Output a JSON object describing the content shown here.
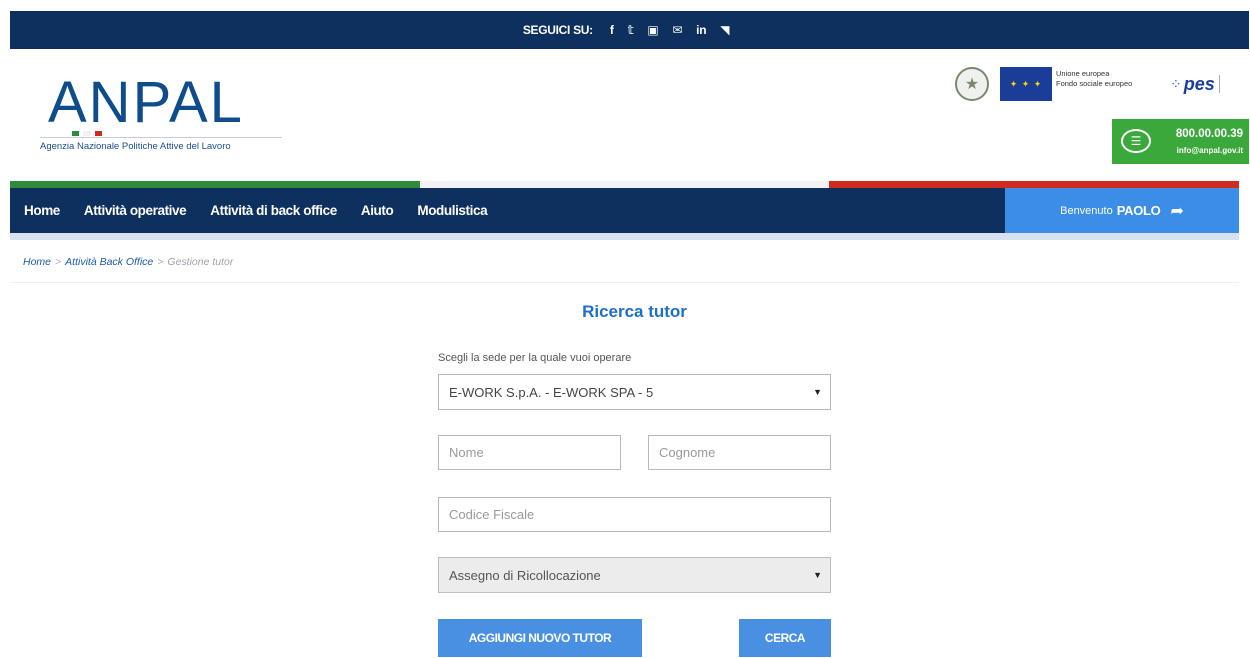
{
  "social": {
    "label": "SEGUICI SU:",
    "icons": [
      "facebook-icon",
      "twitter-icon",
      "youtube-icon",
      "mail-icon",
      "linkedin-icon",
      "rss-icon"
    ],
    "glyphs": [
      "f",
      "𝕥",
      "▣",
      "✉",
      "in",
      "◥"
    ]
  },
  "header": {
    "logo_text": "ANPAL",
    "logo_subtitle": "Agenzia Nazionale Politiche Attive del Lavoro",
    "eu_line1": "Unione europea",
    "eu_line2": "Fondo sociale europeo",
    "pes_text": "pes",
    "phone": "800.00.00.39",
    "email": "info@anpal.gov.it"
  },
  "nav": {
    "items": [
      "Home",
      "Attività operative",
      "Attività di back office",
      "Aiuto",
      "Modulistica"
    ],
    "welcome_prefix": "Benvenuto",
    "welcome_user": "PAOLO"
  },
  "breadcrumb": {
    "items": [
      "Home",
      "Attività Back Office",
      "Gestione tutor"
    ],
    "separator": ">"
  },
  "form": {
    "title": "Ricerca tutor",
    "sede_label": "Scegli la sede per la quale vuoi operare",
    "sede_value": "E-WORK S.p.A. - E-WORK SPA - 5",
    "nome_placeholder": "Nome",
    "cognome_placeholder": "Cognome",
    "codice_fiscale_placeholder": "Codice Fiscale",
    "misura_value": "Assegno di Ricollocazione",
    "add_button": "AGGIUNGI NUOVO TUTOR",
    "search_button": "CERCA"
  },
  "colors": {
    "dark_blue": "#0e305f",
    "accent_blue": "#4a90e2",
    "title_blue": "#1f6fc6",
    "green": "#3ba83c",
    "flag_green": "#2e8b3a",
    "flag_white": "#f2f2f2",
    "flag_red": "#d02b20"
  }
}
